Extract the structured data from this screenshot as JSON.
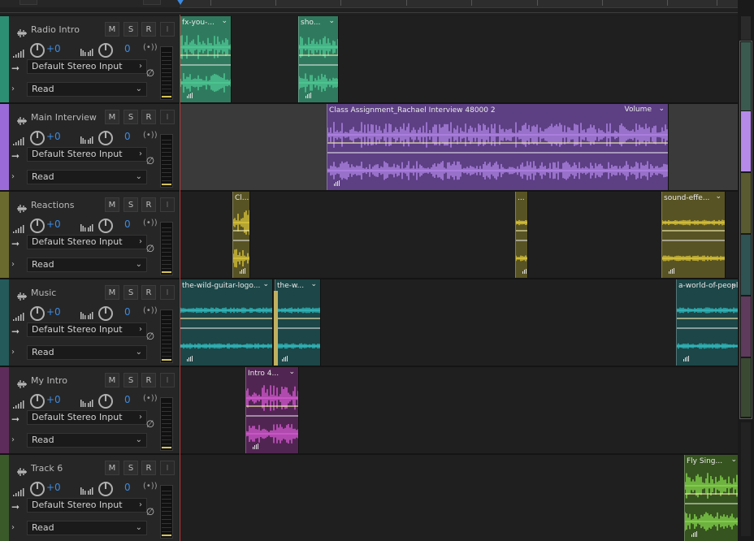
{
  "tracks": [
    {
      "name": "Radio Intro",
      "color": "#2c8f74",
      "volume": "+0",
      "pan": "0",
      "input": "Default Stereo Input",
      "automation": "Read",
      "buttons": [
        "M",
        "S",
        "R",
        "I"
      ],
      "clips": [
        {
          "title": "fx-you-...",
          "color": "#2f7a5e",
          "wave": "#52d39b"
        },
        {
          "title": "sho...",
          "color": "#2f7a5e",
          "wave": "#52d39b"
        }
      ]
    },
    {
      "name": "Main Interview",
      "color": "#9a6bd8",
      "volume": "+0",
      "pan": "0",
      "input": "Default Stereo Input",
      "automation": "Read",
      "buttons": [
        "M",
        "S",
        "R",
        "I"
      ],
      "clips": [
        {
          "title": "Class Assignment_Rachael Interview 48000 2",
          "label": "Volume",
          "color": "#5d3f84",
          "wave": "#b98cf0"
        }
      ]
    },
    {
      "name": "Reactions",
      "color": "#6b6a2e",
      "volume": "+0",
      "pan": "0",
      "input": "Default Stereo Input",
      "automation": "Read",
      "buttons": [
        "M",
        "S",
        "R",
        "I"
      ],
      "clips": [
        {
          "title": "Cl...",
          "color": "#585324",
          "wave": "#e8d13b"
        },
        {
          "title": "...",
          "color": "#585324",
          "wave": "#e8d13b"
        },
        {
          "title": "sound-effe...",
          "color": "#585324",
          "wave": "#e8d13b"
        }
      ]
    },
    {
      "name": "Music",
      "color": "#245a5a",
      "volume": "+0",
      "pan": "0",
      "input": "Default Stereo Input",
      "automation": "Read",
      "buttons": [
        "M",
        "S",
        "R",
        "I"
      ],
      "clips": [
        {
          "title": "the-wild-guitar-logo...",
          "color": "#1c4647",
          "wave": "#33c8cc"
        },
        {
          "title": "the-w...",
          "color": "#1c4647",
          "wave": "#33c8cc"
        },
        {
          "title": "a-world-of-people",
          "color": "#1c4647",
          "wave": "#33c8cc"
        }
      ]
    },
    {
      "name": "My Intro",
      "color": "#5e2c5a",
      "volume": "+0",
      "pan": "0",
      "input": "Default Stereo Input",
      "automation": "Read",
      "buttons": [
        "M",
        "S",
        "R",
        "I"
      ],
      "clips": [
        {
          "title": "Intro 4...",
          "color": "#512552",
          "wave": "#e35ee0"
        }
      ]
    },
    {
      "name": "Track 6",
      "color": "#3a5a2a",
      "volume": "+0",
      "pan": "0",
      "input": "Default Stereo Input",
      "automation": "Read",
      "buttons": [
        "M",
        "S",
        "R",
        "I"
      ],
      "clips": [
        {
          "title": "Fly Sing...",
          "color": "#36541f",
          "wave": "#8ee552"
        }
      ]
    }
  ],
  "colors": {
    "playhead": "#c83535",
    "accent": "#3c8ae0",
    "meter_level": "#d6c45a"
  },
  "icons": [
    "waveform-icon",
    "volume-icon",
    "pan-icon",
    "stereo-icon",
    "input-arrow-icon",
    "phase-invert-icon",
    "expand-chevron-icon",
    "dropdown-chevron-icon"
  ]
}
